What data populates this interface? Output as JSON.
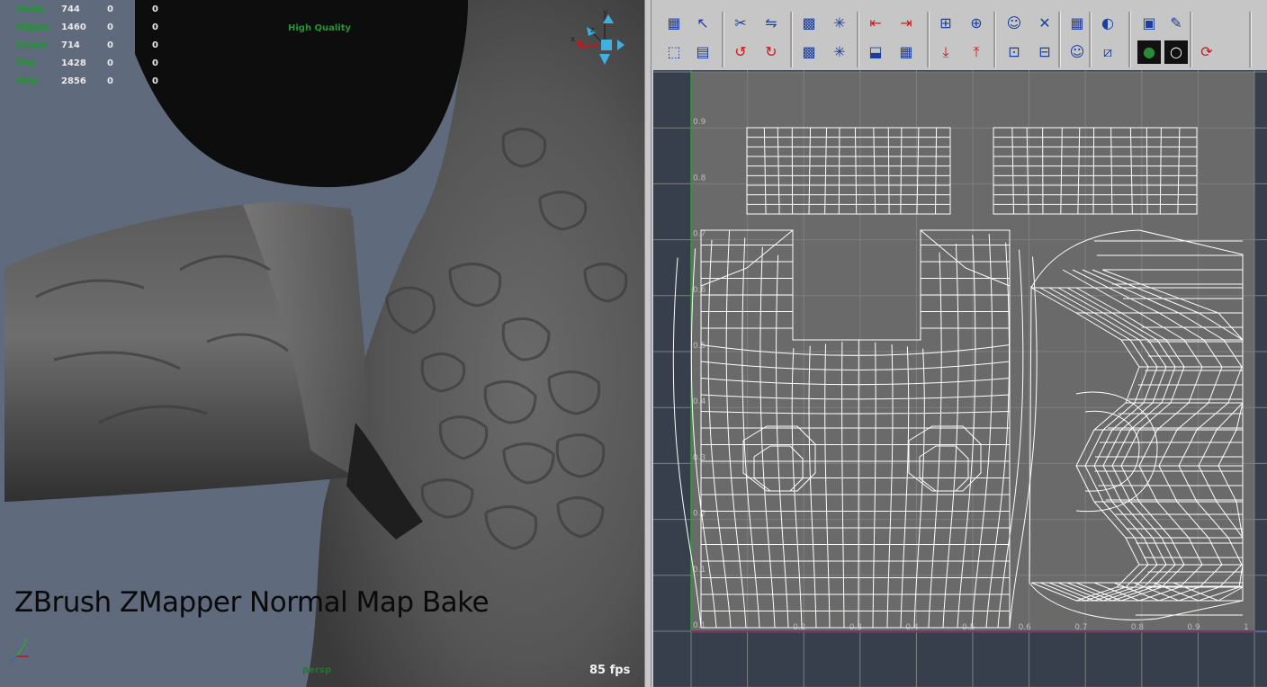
{
  "viewport": {
    "stats": [
      {
        "label": "Verts:",
        "values": [
          "744",
          "0",
          "0"
        ]
      },
      {
        "label": "Edges:",
        "values": [
          "1460",
          "0",
          "0"
        ]
      },
      {
        "label": "Faces:",
        "values": [
          "714",
          "0",
          "0"
        ]
      },
      {
        "label": "Tris:",
        "values": [
          "1428",
          "0",
          "0"
        ]
      },
      {
        "label": "UVs:",
        "values": [
          "2856",
          "0",
          "0"
        ]
      }
    ],
    "quality_label": "High Quality",
    "caption": "ZBrush ZMapper Normal Map Bake",
    "fps": "85 fps",
    "camera": "persp",
    "axis": {
      "x": "x",
      "y": "y",
      "z": "z"
    }
  },
  "uv_editor": {
    "tick_labels_u": [
      "0.2",
      "0.3",
      "0.4",
      "0.5",
      "0.6",
      "0.7",
      "0.8",
      "0.9",
      "1"
    ],
    "tick_labels_v": [
      "0.9",
      "0.8",
      "0.7",
      "0.6",
      "0.5",
      "0.4",
      "0.3",
      "0.2",
      "0.1",
      "0.1"
    ],
    "toolbar_icons": [
      "checker-icon",
      "move-uv-icon",
      "cut-uv-icon",
      "sew-uv-icon",
      "map-checker-icon",
      "uv-snapshot-icon",
      "align-left-icon",
      "align-right-icon",
      "grid-icon",
      "grid-plus-icon",
      "camera-user-icon",
      "cross-checker-icon",
      "display-grid-icon",
      "magnet-icon",
      "texture-borders-icon",
      "brush-user-icon",
      "select-shell-icon",
      "lattice-icon",
      "rotate-ccw-icon",
      "rotate-cw-icon",
      "unfold-icon",
      "relax-icon",
      "layout-icon",
      "grid-checker-icon",
      "align-bottom-icon",
      "align-top-icon",
      "grid-dot-icon",
      "grid-minus-icon",
      "portrait-icon",
      "isolate-icon",
      "color-sphere-icon",
      "white-circle-icon",
      "refresh-icon"
    ],
    "colors": {
      "canvas": "#6a6a6a",
      "wire": "#ffffff",
      "u_axis": "#c02020",
      "v_axis": "#20a020",
      "background": "#373e4c"
    }
  }
}
